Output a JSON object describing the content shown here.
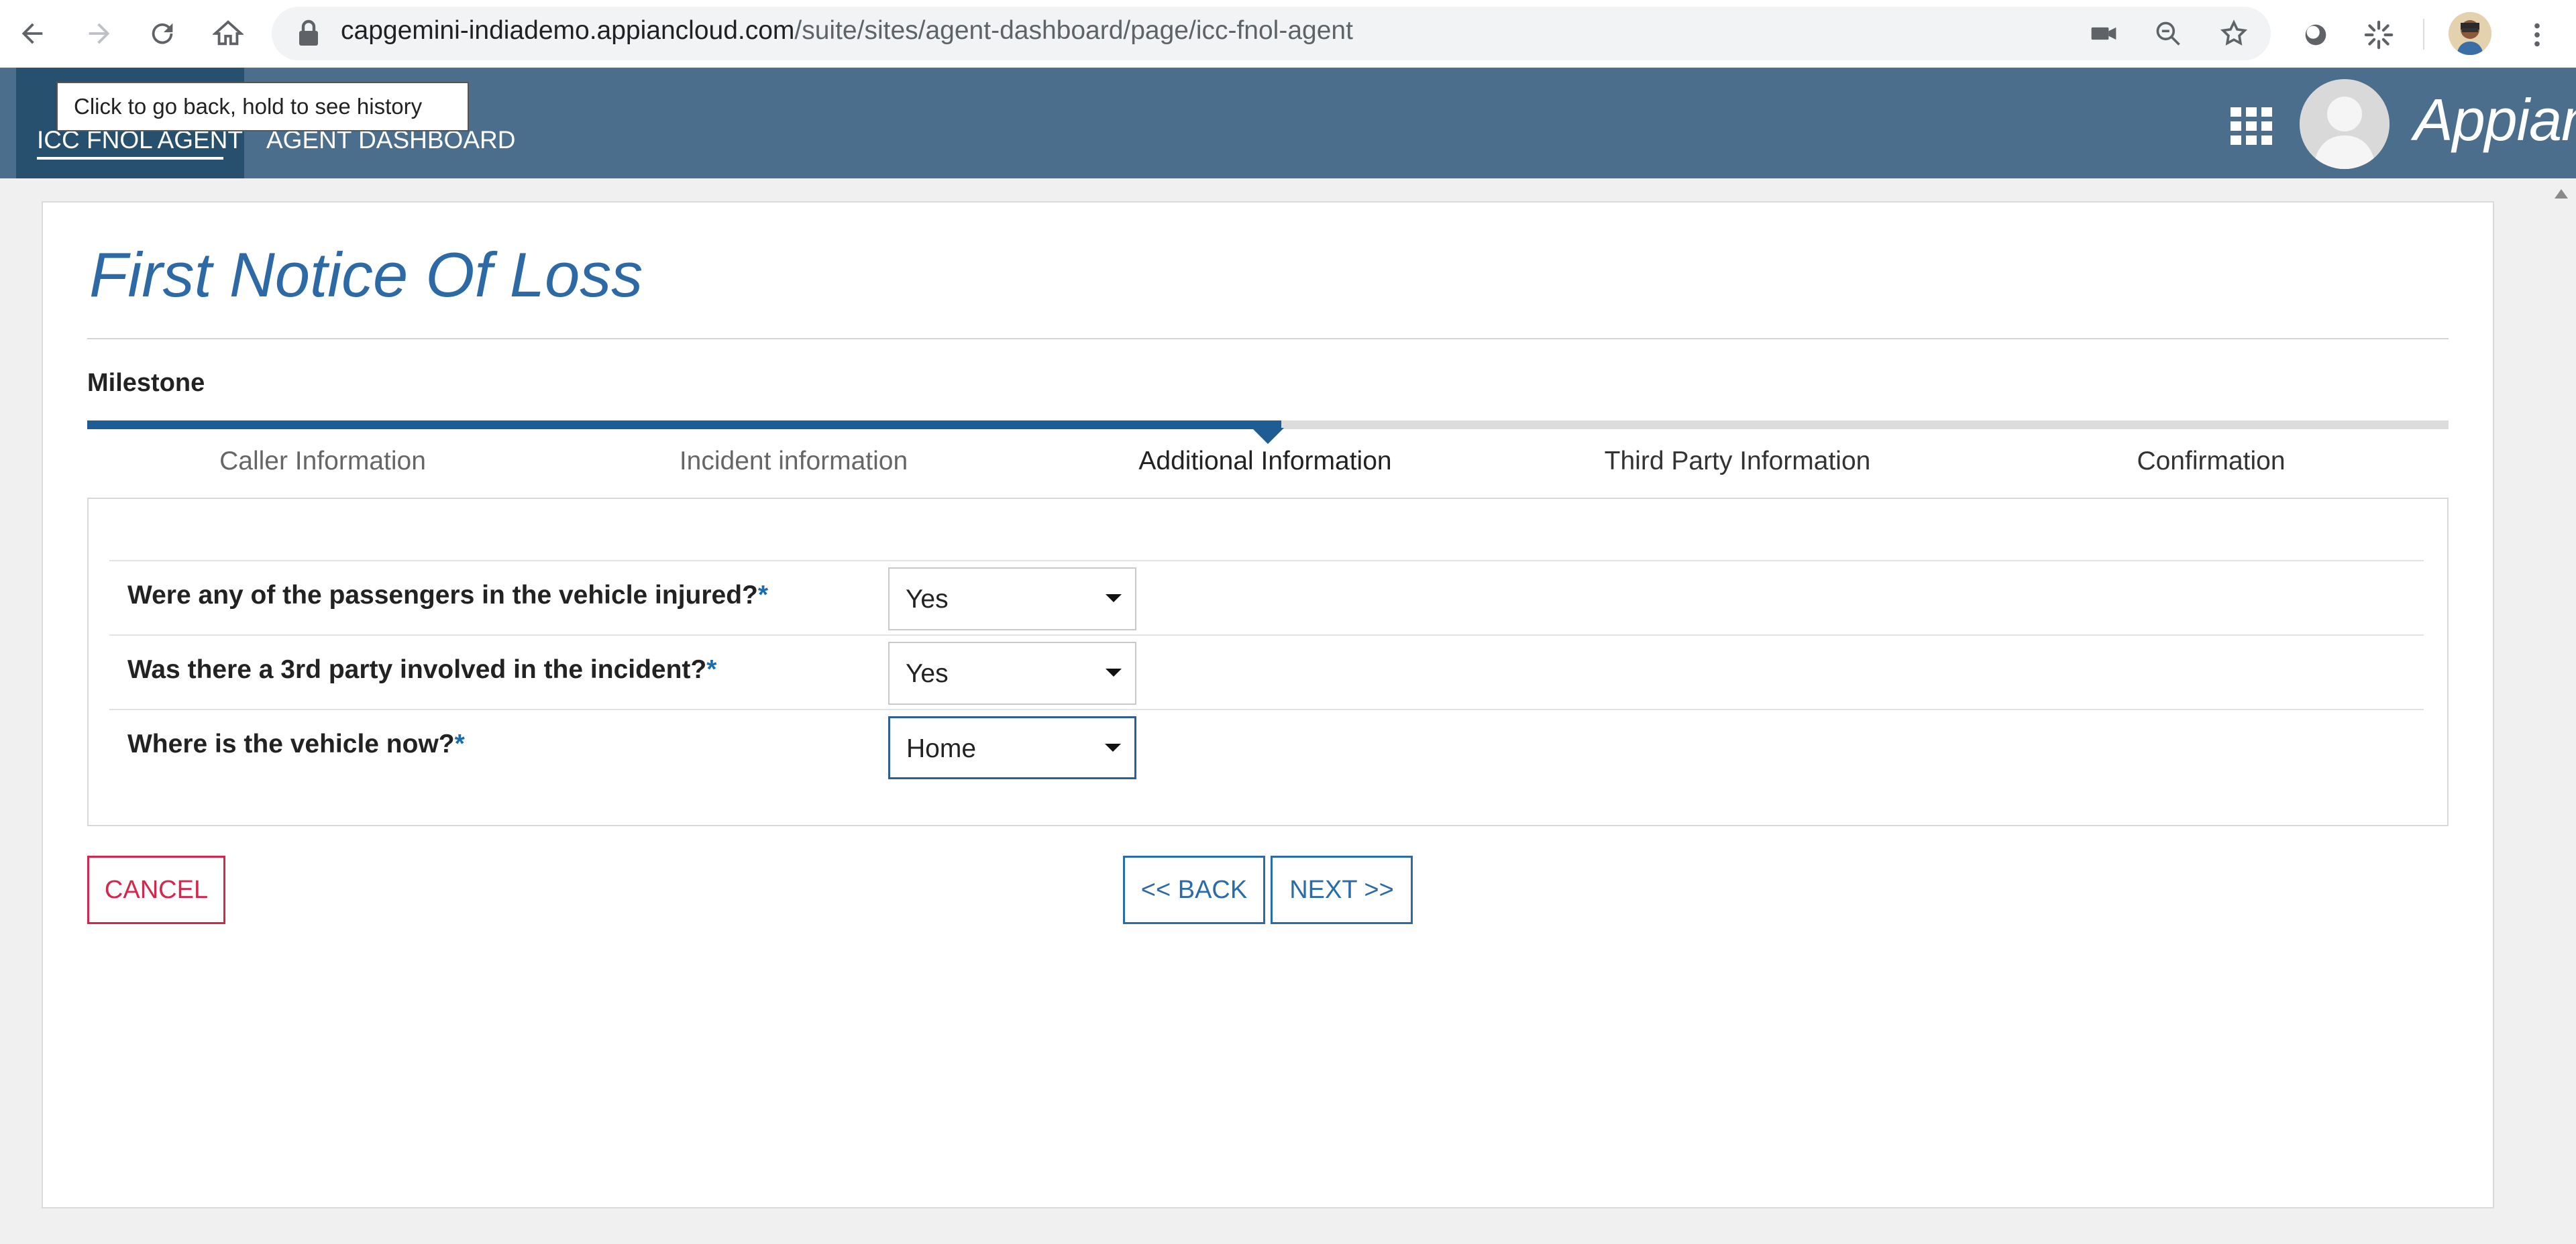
{
  "browser": {
    "url_host": "capgemini-indiademo.appiancloud.com",
    "url_path": "/suite/sites/agent-dashboard/page/icc-fnol-agent",
    "tooltip": "Click to go back, hold to see history"
  },
  "header": {
    "tabs": [
      {
        "label": "ICC FNOL AGENT"
      },
      {
        "label": "AGENT DASHBOARD"
      }
    ],
    "brand": "Appian",
    "colors": {
      "header_bg": "#4a6e8c",
      "active_tab_bg": "#27506f"
    }
  },
  "page": {
    "title": "First Notice Of Loss",
    "milestone_label": "Milestone",
    "milestone_progress": 0.5,
    "steps": [
      {
        "label": "Caller Information",
        "state": "done"
      },
      {
        "label": "Incident information",
        "state": "done"
      },
      {
        "label": "Additional Information",
        "state": "current"
      },
      {
        "label": "Third Party Information",
        "state": "todo"
      },
      {
        "label": "Confirmation",
        "state": "todo"
      }
    ]
  },
  "form": {
    "questions": [
      {
        "label": "Were any of the passengers in the vehicle injured?",
        "required": "*",
        "value": "Yes"
      },
      {
        "label": "Was there a 3rd party involved in the incident?",
        "required": "*",
        "value": "Yes"
      },
      {
        "label": "Where is the vehicle now?",
        "required": "*",
        "value": "Home"
      }
    ]
  },
  "buttons": {
    "cancel": "CANCEL",
    "back": "<< BACK",
    "next": "NEXT >>"
  }
}
